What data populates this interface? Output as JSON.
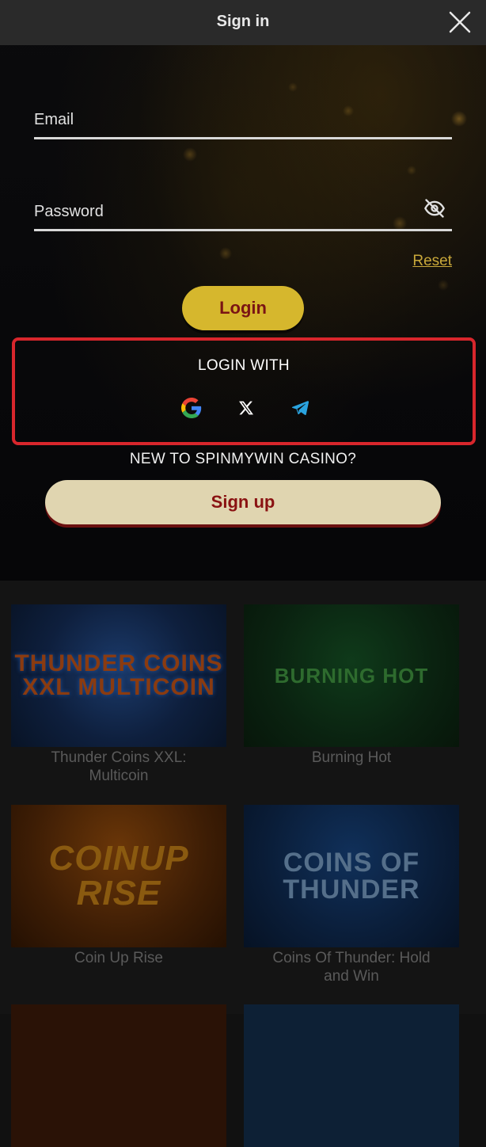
{
  "modal": {
    "title": "Sign in",
    "close_icon": "close-icon",
    "email_placeholder": "Email",
    "password_placeholder": "Password",
    "password_toggle_icon": "eye-off-icon",
    "reset_label": "Reset",
    "login_label": "Login",
    "login_with_label": "LOGIN WITH",
    "social": [
      {
        "name": "google",
        "icon": "google-icon"
      },
      {
        "name": "x",
        "icon": "x-icon"
      },
      {
        "name": "telegram",
        "icon": "telegram-icon"
      }
    ],
    "new_to_label": "NEW TO SPINMYWIN CASINO?",
    "signup_label": "Sign up"
  },
  "games": [
    {
      "title": "Thunder Coins XXL: Multicoin",
      "art": "THUNDER COINS XXL MULTICOIN"
    },
    {
      "title": "Burning Hot",
      "art": "BURNING HOT"
    },
    {
      "title": "Coin Up Rise",
      "art": "COINUP RISE"
    },
    {
      "title": "Coins Of Thunder: Hold and Win",
      "art": "COINS OF THUNDER"
    }
  ],
  "colors": {
    "accent_gold": "#d6b72d",
    "signup_bg": "#e0d5b0",
    "button_text": "#7a1414",
    "highlight_red": "#d8262c",
    "link_gold": "#c9a83a"
  }
}
